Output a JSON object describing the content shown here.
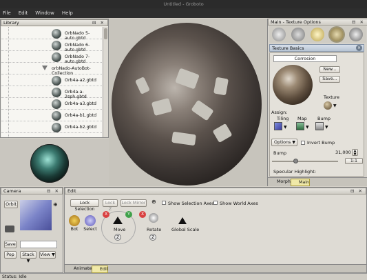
{
  "window": {
    "title": "Untitled - Groboto"
  },
  "menu": [
    "File",
    "Edit",
    "Window",
    "Help"
  ],
  "library": {
    "title": "Library",
    "items": [
      {
        "label": "OrbNado 5-auto.gbtd",
        "group": false
      },
      {
        "label": "OrbNado 6-auto.gbtd",
        "group": false
      },
      {
        "label": "OrbNado 7-auto.gbtd",
        "group": false
      },
      {
        "label": "orbNado-AutoBot-Collection",
        "group": true
      },
      {
        "label": "Orb4a-a2.gbtd",
        "group": false
      },
      {
        "label": "Orb4a-a-2sph.gbtd",
        "group": false
      },
      {
        "label": "Orb4a-a3.gbtd",
        "group": false
      },
      {
        "label": "Orb4a-b1.gbtd",
        "group": false
      },
      {
        "label": "Orb4a-b2.gbtd",
        "group": false
      }
    ]
  },
  "texture": {
    "panel_title": "Main - Texture Options",
    "basics_title": "Texture Basics",
    "name": "Corrosion",
    "new_label": "New...",
    "save_label": "Save...",
    "texture_label": "Texture",
    "assign_label": "Assign:",
    "tiling_label": "Tiling",
    "map_label": "Map",
    "bump_label": "Bump",
    "options_label": "Options",
    "invert_bump_label": "Invert Bump",
    "bump_title": "Bump",
    "bump_value": "31,000",
    "bump_fraction": 0.35,
    "ratio_label": "1:1",
    "specular_label": "Specular Highlight:",
    "tabs": [
      "Morph",
      "Main"
    ],
    "active_tab": "Main"
  },
  "camera": {
    "title": "Camera",
    "orbit_label": "Orbit",
    "save_label": "Save",
    "save_field": "",
    "pop_label": "Pop",
    "stack_label": "Stack",
    "view_label": "View"
  },
  "edit": {
    "title": "Edit",
    "lock_selection": "Lock Selection",
    "lock_z": "Lock Z",
    "lock_mirror": "Lock Mirror",
    "show_selection_axes": "Show Selection Axes",
    "show_world_axes": "Show World Axes",
    "tools": {
      "bot": "Bot",
      "select": "Select",
      "move": "Move",
      "rotate": "Rotate",
      "global_scale": "Global Scale"
    },
    "axis": {
      "x": "X",
      "y": "Y",
      "z": "Z"
    },
    "tabs": [
      "Animate",
      "Edit"
    ],
    "active_tab": "Edit"
  },
  "status": "Status: Idle",
  "colors": {
    "accent_tab": "#f0e9a8",
    "axis_x": "#d94040",
    "axis_y": "#3fa14a",
    "titlebar": "#2b2b2b"
  }
}
